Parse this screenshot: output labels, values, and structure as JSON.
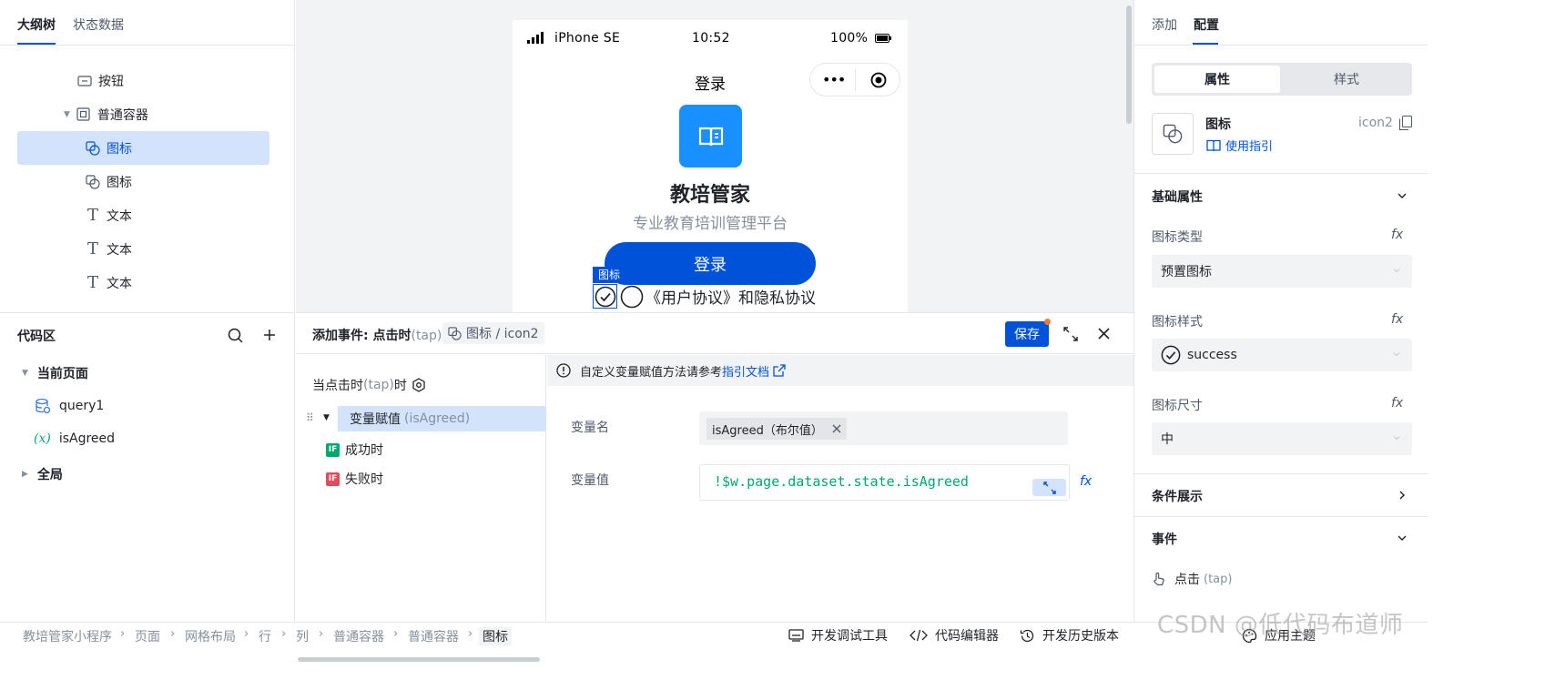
{
  "outline": {
    "tabs": [
      {
        "label": "大纲树"
      },
      {
        "label": "状态数据"
      }
    ],
    "items": [
      {
        "label": "按钮"
      },
      {
        "label": "普通容器"
      },
      {
        "label": "图标"
      },
      {
        "label": "图标"
      },
      {
        "label": "文本"
      },
      {
        "label": "文本"
      },
      {
        "label": "文本"
      }
    ]
  },
  "phone": {
    "carrier": "iPhone SE",
    "time": "10:52",
    "battery": "100%",
    "nav_title": "登录",
    "app_name": "教培管家",
    "subtitle": "专业教育培训管理平台",
    "login_button": "登录",
    "selected_tag": "图标",
    "agreement_text": "《用户协议》和隐私协议"
  },
  "right_panel": {
    "tabs": [
      {
        "label": "添加"
      },
      {
        "label": "配置"
      }
    ],
    "segment": [
      {
        "label": "属性"
      },
      {
        "label": "样式"
      }
    ],
    "component_name": "图标",
    "component_id": "icon2",
    "guide_link": "使用指引",
    "basic_props_title": "基础属性",
    "icon_type_label": "图标类型",
    "icon_type_value": "预置图标",
    "icon_style_label": "图标样式",
    "icon_style_value": "success",
    "icon_size_label": "图标尺寸",
    "icon_size_value": "中",
    "fx_label": "fx",
    "condition_title": "条件展示",
    "events_title": "事件",
    "event_item": "点击",
    "event_item_sub": "(tap)"
  },
  "code_area": {
    "title": "代码区",
    "current_page": "当前页面",
    "items": [
      {
        "label": "query1"
      },
      {
        "label": "isAgreed"
      }
    ],
    "global": "全局"
  },
  "event_panel": {
    "title_prefix": "添加事件: 点击时",
    "title_suffix": "(tap)",
    "component_chip": "图标 / icon2",
    "save_label": "保存",
    "trigger_prefix": "当点击时",
    "trigger_tap": "(tap)",
    "trigger_suffix": "时",
    "action_label": "变量赋值",
    "action_sub": "(isAgreed)",
    "success_label": "成功时",
    "fail_label": "失败时",
    "if_badge": "IF",
    "info_text": "自定义变量赋值方法请参考",
    "info_link": "指引文档",
    "var_name_label": "变量名",
    "var_name_value": "isAgreed（布尔值）",
    "var_value_label": "变量值",
    "var_value_code": "!$w.page.dataset.state.isAgreed",
    "fx_label": "fx"
  },
  "bottom_bar": {
    "breadcrumbs": [
      "教培管家小程序",
      "页面",
      "网格布局",
      "行",
      "列",
      "普通容器",
      "普通容器",
      "图标"
    ],
    "tools": [
      {
        "label": "开发调试工具"
      },
      {
        "label": "代码编辑器"
      },
      {
        "label": "开发历史版本"
      },
      {
        "label": "应用主题"
      }
    ]
  },
  "watermark": "CSDN @低代码布道师",
  "colors": {
    "primary": "#0052d9",
    "selected_bg": "#d4e3fc",
    "app_icon_bg": "#1890ff",
    "code_green": "#00a870",
    "if_success": "#00a870",
    "if_fail": "#e34d59"
  }
}
